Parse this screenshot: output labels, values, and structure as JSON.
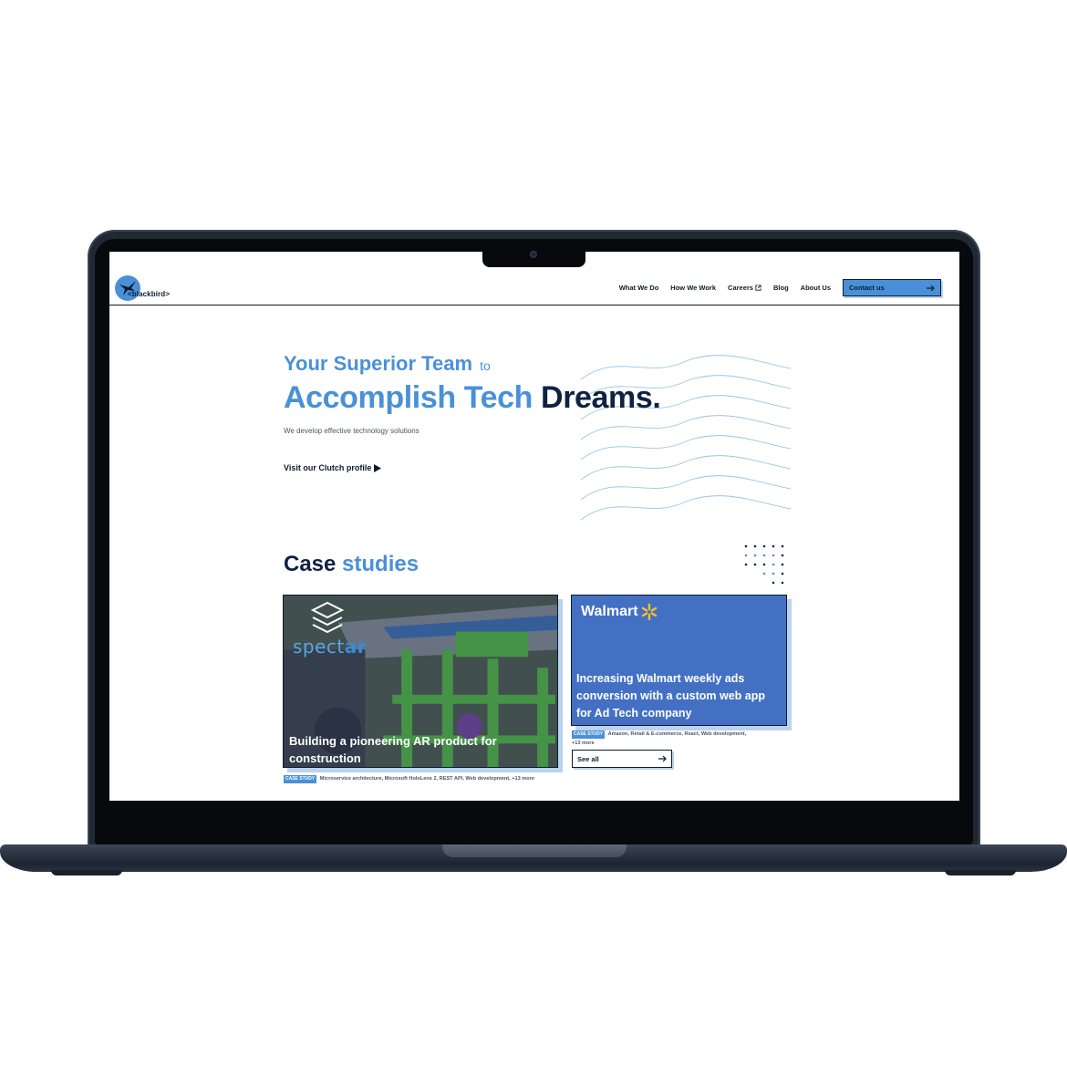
{
  "header": {
    "logo_text": "<blackbird>",
    "nav": [
      "What We Do",
      "How We Work",
      "Careers",
      "Blog",
      "About Us"
    ],
    "contact_label": "Contact us"
  },
  "hero": {
    "line1_main": "Your Superior Team",
    "line1_to": "to",
    "line2_light": "Accomplish Tech",
    "line2_dark": "Dreams.",
    "subtitle": "We develop effective technology solutions",
    "clutch_link": "Visit our Clutch profile"
  },
  "case_studies": {
    "title_dark": "Case",
    "title_accent": "studies",
    "cards": [
      {
        "brand": "spectar",
        "brand_a": "spect",
        "brand_b": "ar",
        "title": "Building a pioneering AR product for construction",
        "badge": "CASE STUDY",
        "tags": "Microservice architecture, Microsoft HoloLens 2, REST API, Web development, +13 more"
      },
      {
        "brand": "Walmart",
        "title": "Increasing Walmart weekly ads conversion with a custom web app for Ad Tech company",
        "badge": "CASE STUDY",
        "tags": "Amazon, Retail & E-commerce, React, Web development, +13 more"
      }
    ],
    "see_all_label": "See all"
  },
  "colors": {
    "accent": "#4a90d9",
    "navy": "#0f2244",
    "walmart_blue": "#4470c4",
    "walmart_spark": "#ffc220"
  },
  "icons": [
    "blackbird-logo-icon",
    "external-link-icon",
    "arrow-right-icon",
    "play-icon",
    "spectar-cube-icon",
    "walmart-spark-icon"
  ]
}
